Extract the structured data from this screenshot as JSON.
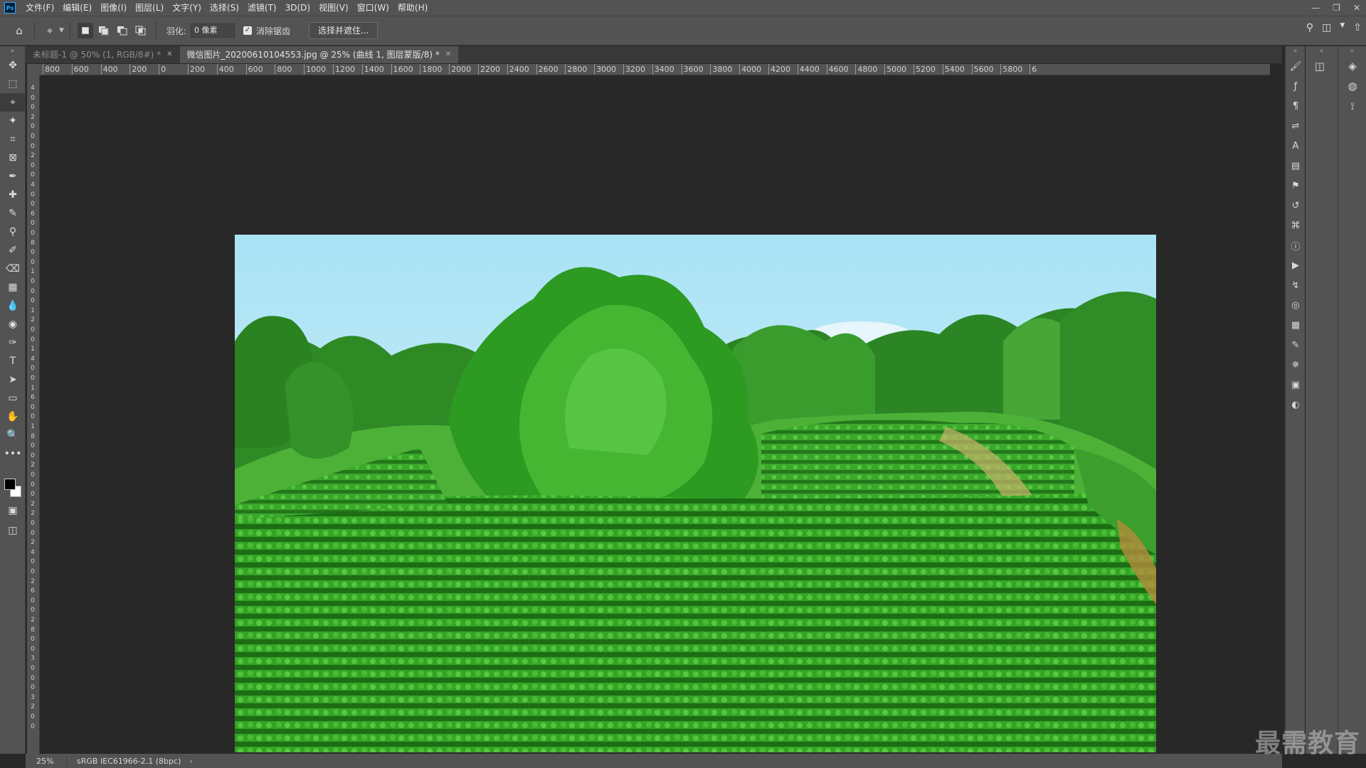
{
  "menubar": {
    "logo": "Ps",
    "items": [
      "文件(F)",
      "编辑(E)",
      "图像(I)",
      "图层(L)",
      "文字(Y)",
      "选择(S)",
      "滤镜(T)",
      "3D(D)",
      "视图(V)",
      "窗口(W)",
      "帮助(H)"
    ],
    "window_controls": [
      "minimize-icon",
      "restore-icon",
      "close-icon"
    ]
  },
  "options": {
    "feather_label": "羽化:",
    "feather_value": "0 像素",
    "antialias_label": "消除锯齿",
    "antialias_checked": true,
    "select_mask_label": "选择并遮住..."
  },
  "tabs": [
    {
      "label": "未标题-1 @ 50% (1, RGB/8#) *",
      "active": false
    },
    {
      "label": "微信图片_20200610104553.jpg @ 25% (曲线 1, 图层蒙版/8) *",
      "active": true
    }
  ],
  "ruler": {
    "h_labels": [
      "800",
      "600",
      "400",
      "200",
      "0",
      "200",
      "400",
      "600",
      "800",
      "1000",
      "1200",
      "1400",
      "1600",
      "1800",
      "2000",
      "2200",
      "2400",
      "2600",
      "2800",
      "3000",
      "3200",
      "3400",
      "3600",
      "3800",
      "4000",
      "4200",
      "4400",
      "4600",
      "4800",
      "5000",
      "5200",
      "5400",
      "5600",
      "5800",
      "6"
    ],
    "v_labels": [
      "4",
      "0",
      "0",
      "2",
      "0",
      "0",
      "0",
      "2",
      "0",
      "0",
      "4",
      "0",
      "0",
      "6",
      "0",
      "0",
      "8",
      "0",
      "0",
      "1",
      "0",
      "0",
      "0",
      "1",
      "2",
      "0",
      "0",
      "1",
      "4",
      "0",
      "0",
      "1",
      "6",
      "0",
      "0",
      "1",
      "8",
      "0",
      "0",
      "2",
      "0",
      "0",
      "0",
      "2",
      "2",
      "0",
      "0",
      "2",
      "4",
      "0",
      "0",
      "2",
      "6",
      "0",
      "0",
      "2",
      "8",
      "0",
      "0",
      "3",
      "0",
      "0",
      "0",
      "3",
      "2",
      "0",
      "0"
    ]
  },
  "status": {
    "zoom": "25%",
    "profile": "sRGB IEC61966-2.1 (8bpc)",
    "arrow": "›"
  },
  "watermark": "最需教育",
  "tools": [
    "move-icon",
    "marquee-icon",
    "polygonal-lasso-icon",
    "magic-wand-icon",
    "crop-icon",
    "frame-icon",
    "eyedropper-icon",
    "healing-brush-icon",
    "brush-icon",
    "clone-stamp-icon",
    "history-brush-icon",
    "eraser-icon",
    "gradient-icon",
    "blur-icon",
    "dodge-icon",
    "pen-icon",
    "type-icon",
    "path-selection-icon",
    "rectangle-icon",
    "hand-icon",
    "zoom-icon",
    "more-tools-icon"
  ],
  "tool_glyphs": [
    "✥",
    "⬚",
    "⌖",
    "✦",
    "⌗",
    "⊠",
    "✒",
    "✚",
    "✎",
    "⚲",
    "✐",
    "⌫",
    "▦",
    "💧",
    "◉",
    "✑",
    "T",
    "➤",
    "▭",
    "✋",
    "🔍",
    "•••"
  ],
  "type_tool_label": "T",
  "more_tools_label": "•••",
  "right_panel_icons": [
    "brush-settings-icon",
    "fx-icon",
    "paragraph-icon",
    "adjustments-icon",
    "character-icon",
    "library-icon",
    "clone-source-icon",
    "history-icon",
    "glyphs-icon",
    "info-icon",
    "actions-icon",
    "paths-icon",
    "3d-icon",
    "table-icon",
    "notes-icon",
    "navigator-icon",
    "properties-icon",
    "color-icon"
  ],
  "right_panel_glyphs": [
    "🖌",
    "ƒ",
    "¶",
    "⇌",
    "A",
    "▤",
    "⚑",
    "↺",
    "⌘",
    "ⓘ",
    "▶",
    "↯",
    "◎",
    "▦",
    "✎",
    "✵",
    "▣",
    "◐"
  ],
  "far_right_icons": [
    "layers-icon",
    "channels-icon",
    "paths-panel-icon"
  ],
  "far_right_glyphs": [
    "◈",
    "◍",
    "⟟"
  ]
}
